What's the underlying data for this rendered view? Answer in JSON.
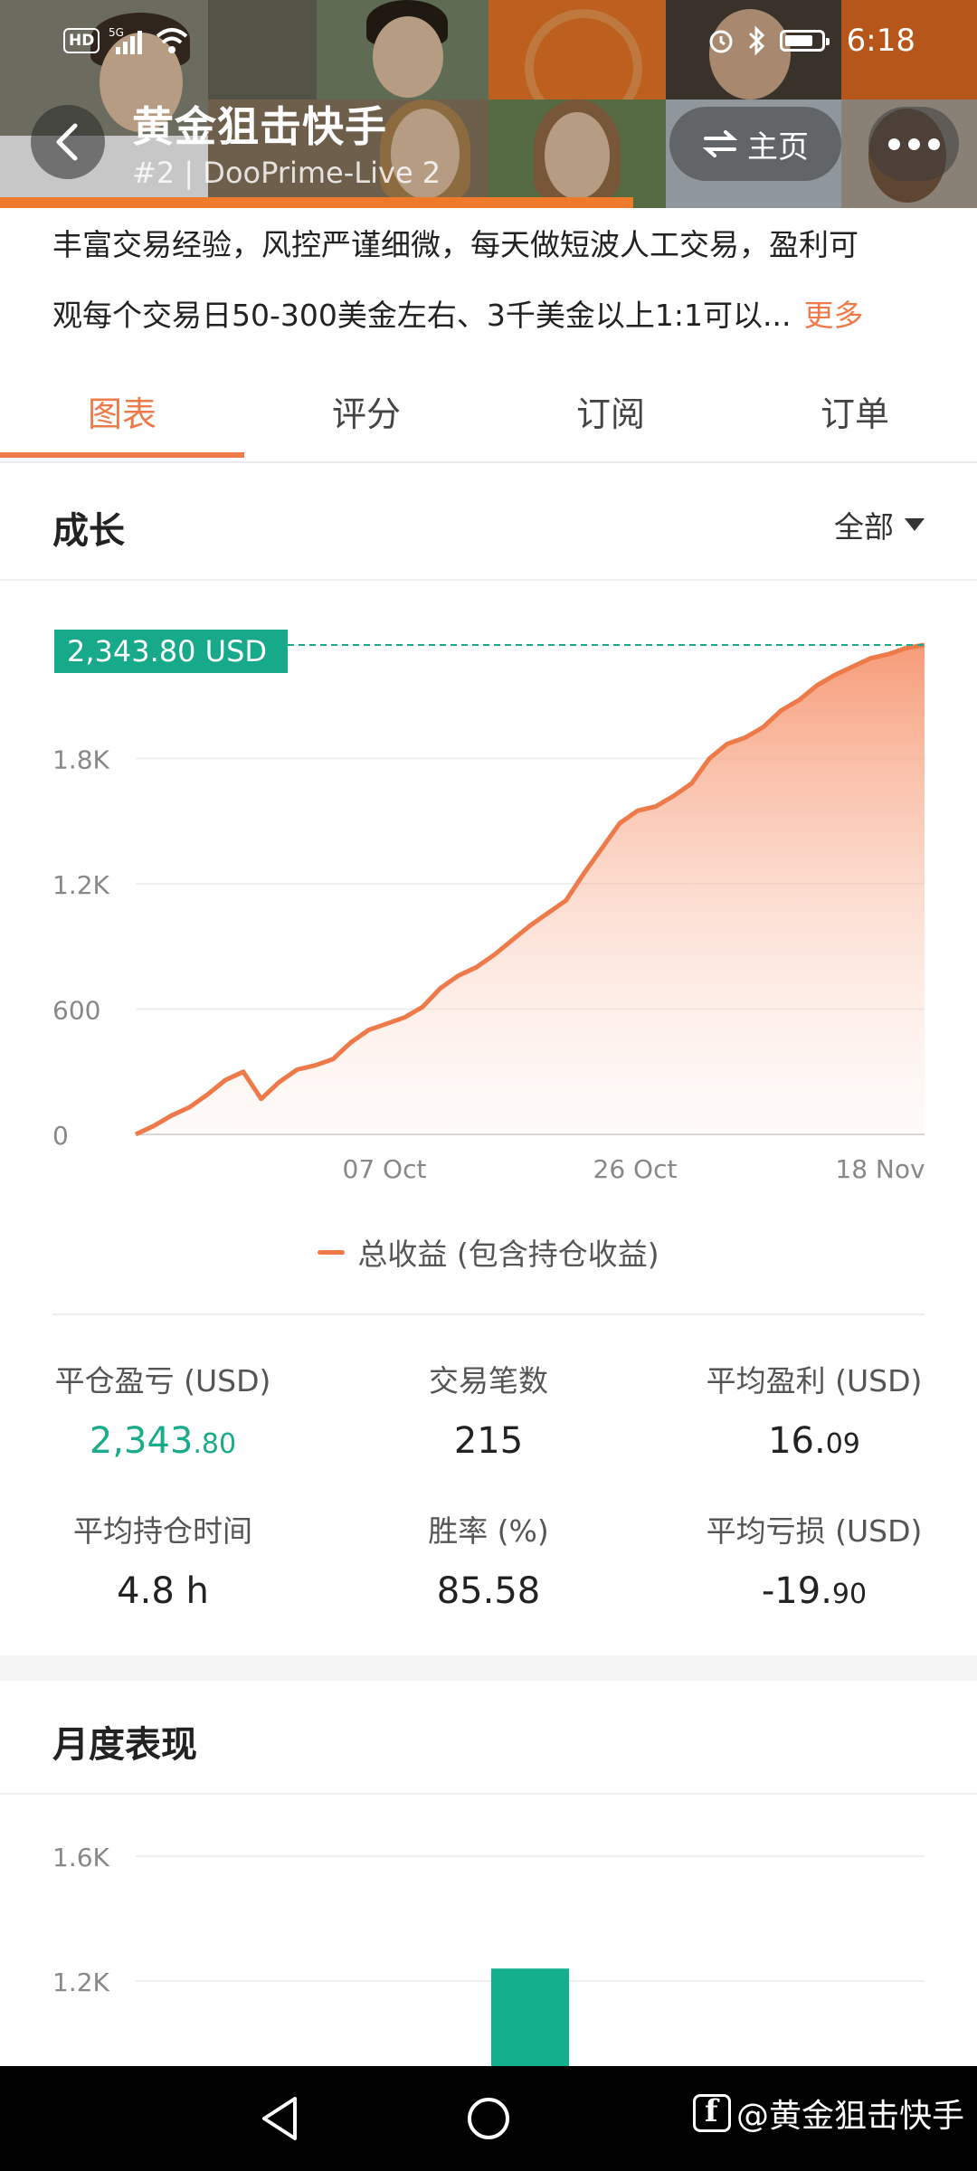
{
  "status_bar": {
    "hd": "HD",
    "network": "5G",
    "time": "6:18"
  },
  "header": {
    "title": "黄金狙击快手",
    "subtitle": "#2 | DooPrime-Live 2",
    "home_label": "主页",
    "icons": [
      "back-arrow-icon",
      "swap-icon",
      "more-dots-icon"
    ]
  },
  "description": {
    "line1": "丰富交易经验，风控严谨细微，每天做短波人工交易，盈利可",
    "line2": "观每个交易日50-300美金左右、3千美金以上1:1可以...",
    "more": "更多"
  },
  "tabs": [
    {
      "label": "图表",
      "active": true
    },
    {
      "label": "评分",
      "active": false
    },
    {
      "label": "订阅",
      "active": false
    },
    {
      "label": "订单",
      "active": false
    }
  ],
  "growth": {
    "title": "成长",
    "filter": "全部",
    "current_value_badge": "2,343.80 USD",
    "legend": "总收益 (包含持仓收益)"
  },
  "chart_data": [
    {
      "type": "area",
      "title": "成长",
      "x_tick_labels": [
        "07 Oct",
        "26 Oct",
        "18 Nov"
      ],
      "y_tick_labels": [
        "0",
        "600",
        "1.2K",
        "1.8K"
      ],
      "ylim": [
        0,
        2400
      ],
      "series": [
        {
          "name": "总收益 (包含持仓收益)",
          "color": "#ee7a4a",
          "x": [
            0,
            2,
            4,
            6,
            8,
            10,
            12,
            14,
            16,
            18,
            20,
            22,
            24,
            26,
            28,
            30,
            32,
            34,
            36,
            38,
            40,
            42,
            44,
            46,
            48,
            50,
            52,
            54,
            56,
            58,
            60,
            62,
            64,
            66,
            68,
            70,
            72,
            74,
            76,
            78,
            80,
            82,
            84,
            86,
            88,
            90,
            92,
            94,
            96,
            98,
            100
          ],
          "values": [
            0,
            40,
            90,
            130,
            190,
            260,
            300,
            170,
            250,
            310,
            330,
            360,
            440,
            500,
            530,
            560,
            610,
            700,
            760,
            800,
            860,
            930,
            1000,
            1060,
            1120,
            1250,
            1370,
            1490,
            1550,
            1570,
            1620,
            1680,
            1800,
            1870,
            1900,
            1950,
            2030,
            2080,
            2150,
            2200,
            2240,
            2280,
            2300,
            2330,
            2343.8,
            2343.8,
            2343.8,
            2343.8,
            2343.8,
            2343.8,
            2343.8
          ]
        }
      ],
      "grid": true
    },
    {
      "type": "bar",
      "title": "月度表现",
      "y_tick_labels": [
        "1.2K",
        "1.6K"
      ],
      "ylim": [
        0,
        1800
      ],
      "series": [
        {
          "color": "#14b08e",
          "values": [
            1240
          ]
        }
      ]
    }
  ],
  "stats": [
    {
      "label": "平仓盈亏 (USD)",
      "main": "2,343",
      "small": ".80",
      "color": "green"
    },
    {
      "label": "交易笔数",
      "main": "215",
      "small": ""
    },
    {
      "label": "平均盈利 (USD)",
      "main": "16.",
      "small": "09"
    },
    {
      "label": "平均持仓时间",
      "main": "4.8 h",
      "small": ""
    },
    {
      "label": "胜率 (%)",
      "main": "85.58",
      "small": ""
    },
    {
      "label": "平均亏损 (USD)",
      "main": "-19.",
      "small": "90"
    }
  ],
  "monthly": {
    "title": "月度表现"
  },
  "watermark": "@黄金狙击快手",
  "navbar": {
    "icons": [
      "nav-back-icon",
      "nav-home-icon"
    ]
  },
  "colors": {
    "accent": "#ee7a4a",
    "positive": "#1aab8a",
    "badge": "#16a98a",
    "bar": "#14b08e"
  }
}
